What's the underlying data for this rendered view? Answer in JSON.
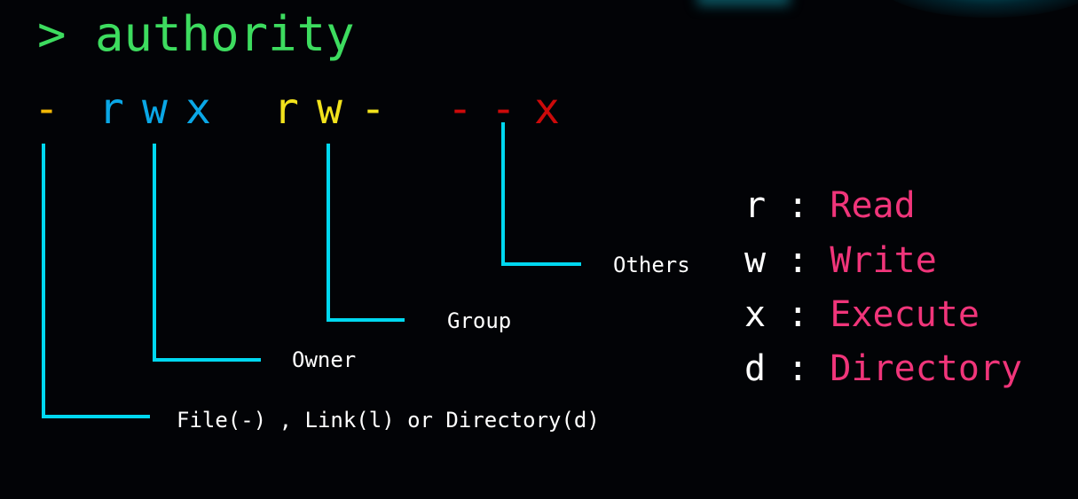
{
  "title": {
    "prompt": ">",
    "text": "authority"
  },
  "permissions": [
    {
      "char": "-",
      "color": "#f2b705"
    },
    {
      "char": "r",
      "color": "#0aa7e6"
    },
    {
      "char": "w",
      "color": "#0aa7e6"
    },
    {
      "char": "x",
      "color": "#0aa7e6"
    },
    {
      "char": "r",
      "color": "#f2e21c"
    },
    {
      "char": "w",
      "color": "#f2e21c"
    },
    {
      "char": "-",
      "color": "#f2e21c"
    },
    {
      "char": "-",
      "color": "#cc0a0a"
    },
    {
      "char": "-",
      "color": "#cc0a0a"
    },
    {
      "char": "x",
      "color": "#cc0a0a"
    }
  ],
  "labels": {
    "type": "File(-) , Link(l) or Directory(d)",
    "owner": "Owner",
    "group": "Group",
    "others": "Others"
  },
  "legend": [
    {
      "key": "r",
      "sep": ":",
      "value": "Read"
    },
    {
      "key": "w",
      "sep": ":",
      "value": "Write"
    },
    {
      "key": "x",
      "sep": ":",
      "value": "Execute"
    },
    {
      "key": "d",
      "sep": ":",
      "value": "Directory"
    }
  ],
  "colors": {
    "title": "#3ddc5f",
    "connector": "#00d8f0",
    "legend_value": "#f0357a"
  }
}
